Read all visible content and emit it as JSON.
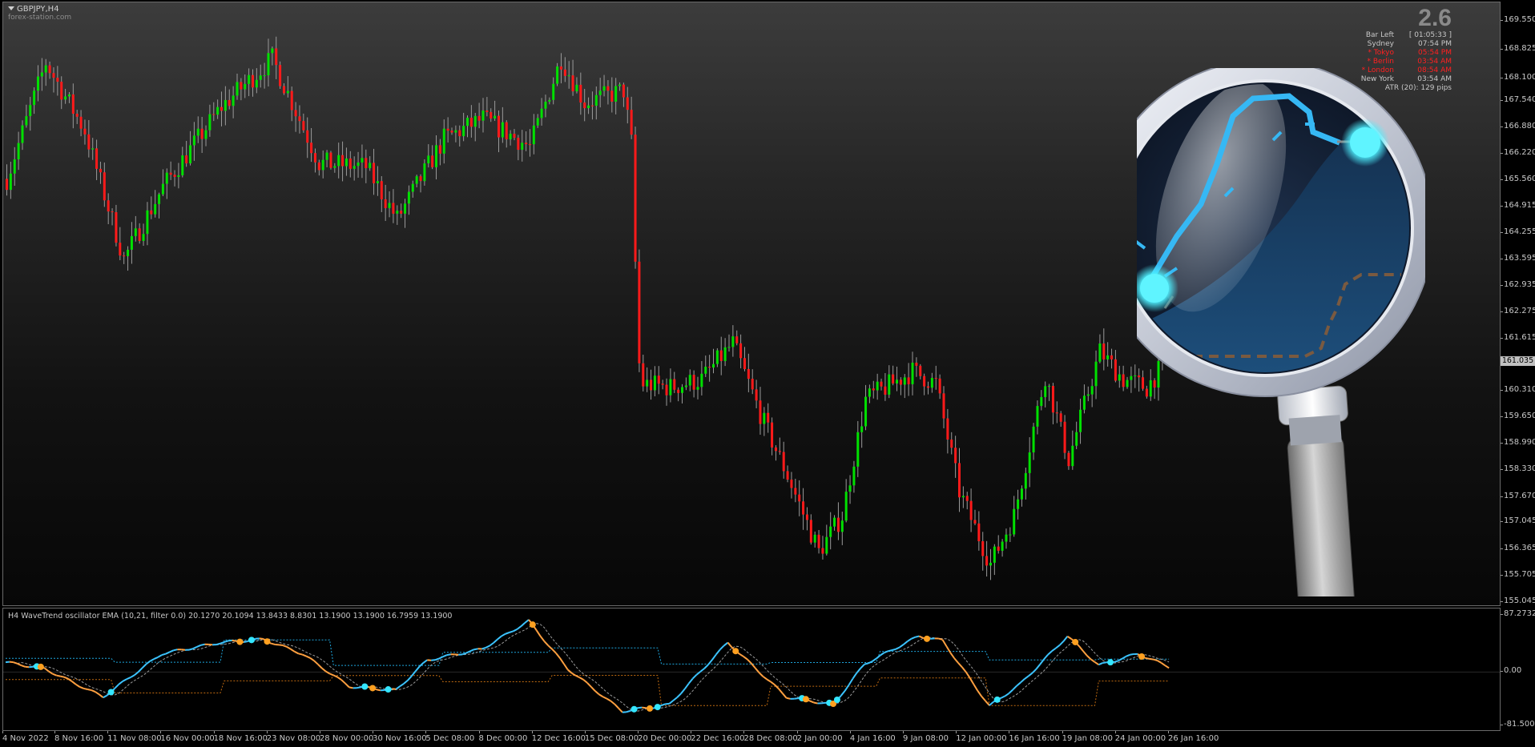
{
  "symbol": "GBPJPY,H4",
  "watermark": "forex-station.com",
  "info": {
    "spread": "2.6",
    "rows": [
      {
        "label": "Bar Left",
        "value": "[ 01:05:33 ]",
        "active": false
      },
      {
        "label": "Sydney",
        "value": "07:54 PM",
        "active": false
      },
      {
        "label": "* Tokyo",
        "value": "05:54 PM",
        "active": true
      },
      {
        "label": "* Berlin",
        "value": "03:54 AM",
        "active": true
      },
      {
        "label": "* London",
        "value": "08:54 AM",
        "active": true
      },
      {
        "label": "New York",
        "value": "03:54 AM",
        "active": false
      }
    ],
    "atr": "ATR (20): 129 pips"
  },
  "current_price": "161.035",
  "price_axis": [
    "169.550",
    "168.825",
    "168.100",
    "167.540",
    "166.880",
    "166.220",
    "165.560",
    "164.915",
    "164.255",
    "163.595",
    "162.935",
    "162.275",
    "161.615",
    "160.310",
    "159.650",
    "158.990",
    "158.330",
    "157.670",
    "157.045",
    "156.365",
    "155.705",
    "155.045"
  ],
  "oscillator": {
    "title": "H4 WaveTrend oscillator EMA (10,21, filter 0.0) 20.1270 20.1094 13.8433 8.8301 13.1900 13.1900 16.7959 13.1900",
    "axis": [
      "87.2732",
      "0.00",
      "-81.5001"
    ]
  },
  "time_axis": [
    "4 Nov 2022",
    "8 Nov 16:00",
    "11 Nov 08:00",
    "16 Nov 00:00",
    "18 Nov 16:00",
    "23 Nov 08:00",
    "28 Nov 00:00",
    "30 Nov 16:00",
    "5 Dec 08:00",
    "8 Dec 00:00",
    "12 Dec 16:00",
    "15 Dec 08:00",
    "20 Dec 00:00",
    "22 Dec 16:00",
    "28 Dec 08:00",
    "2 Jan 00:00",
    "4 Jan 16:00",
    "9 Jan 08:00",
    "12 Jan 00:00",
    "16 Jan 16:00",
    "19 Jan 08:00",
    "24 Jan 00:00",
    "26 Jan 16:00"
  ],
  "chart_data": {
    "type": "candlestick",
    "price_range": [
      155.045,
      169.8
    ],
    "bull_color": "#00e000",
    "bear_color": "#ff1a1a",
    "waypoints": [
      [
        0,
        165.6
      ],
      [
        10,
        168.5
      ],
      [
        20,
        166.8
      ],
      [
        30,
        163.6
      ],
      [
        40,
        165.4
      ],
      [
        55,
        167.4
      ],
      [
        68,
        168.6
      ],
      [
        80,
        166.0
      ],
      [
        92,
        165.9
      ],
      [
        100,
        164.6
      ],
      [
        112,
        166.6
      ],
      [
        122,
        167.1
      ],
      [
        134,
        166.4
      ],
      [
        142,
        168.6
      ],
      [
        148,
        167.5
      ],
      [
        158,
        167.8
      ],
      [
        160,
        166.5
      ],
      [
        162,
        160.5
      ],
      [
        170,
        160.4
      ],
      [
        178,
        160.6
      ],
      [
        186,
        161.5
      ],
      [
        194,
        159.5
      ],
      [
        200,
        158.2
      ],
      [
        208,
        156.3
      ],
      [
        214,
        157.2
      ],
      [
        220,
        160.1
      ],
      [
        232,
        160.8
      ],
      [
        238,
        160.5
      ],
      [
        244,
        157.8
      ],
      [
        252,
        156.0
      ],
      [
        258,
        157.2
      ],
      [
        266,
        160.7
      ],
      [
        272,
        158.6
      ],
      [
        280,
        161.3
      ],
      [
        286,
        160.6
      ],
      [
        292,
        160.4
      ],
      [
        298,
        161.2
      ]
    ],
    "wavetrend": {
      "range": [
        -81.5,
        87.27
      ],
      "waypoints": [
        [
          0,
          15
        ],
        [
          10,
          5
        ],
        [
          25,
          -38
        ],
        [
          40,
          28
        ],
        [
          55,
          45
        ],
        [
          66,
          50
        ],
        [
          76,
          28
        ],
        [
          88,
          -22
        ],
        [
          100,
          -28
        ],
        [
          108,
          18
        ],
        [
          122,
          35
        ],
        [
          134,
          78
        ],
        [
          144,
          5
        ],
        [
          158,
          -60
        ],
        [
          170,
          -50
        ],
        [
          185,
          45
        ],
        [
          200,
          -38
        ],
        [
          212,
          -50
        ],
        [
          220,
          12
        ],
        [
          234,
          55
        ],
        [
          240,
          48
        ],
        [
          252,
          -52
        ],
        [
          260,
          -18
        ],
        [
          272,
          55
        ],
        [
          280,
          10
        ],
        [
          290,
          28
        ],
        [
          298,
          8
        ]
      ]
    }
  }
}
